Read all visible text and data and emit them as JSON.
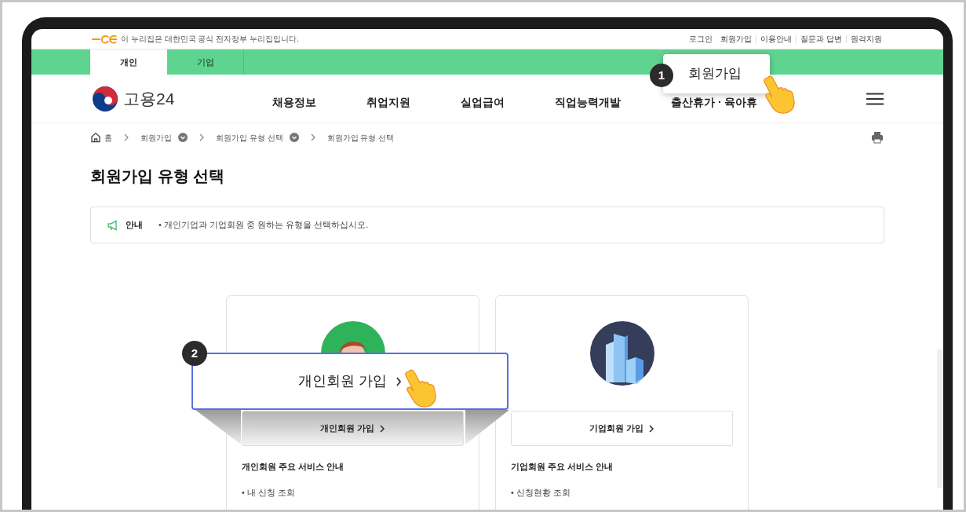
{
  "gov_banner": {
    "text": "이 누리집은 대한민국 공식 전자정부 누리집입니다."
  },
  "utility_links": [
    {
      "label": "로그인"
    },
    {
      "label": "회원가입"
    },
    {
      "label": "이용안내"
    },
    {
      "label": "질문과 답변"
    },
    {
      "label": "원격지원"
    }
  ],
  "audience_tabs": [
    {
      "label": "개인",
      "selected": true
    },
    {
      "label": "기업",
      "selected": false
    }
  ],
  "header": {
    "logo_text": "고용24",
    "nav": [
      "채용정보",
      "취업지원",
      "실업급여",
      "직업능력개발",
      "출산휴가 · 육아휴"
    ]
  },
  "breadcrumb": [
    {
      "label": "홈",
      "kind": "home"
    },
    {
      "label": "회원가입",
      "kind": "dropdown"
    },
    {
      "label": "회원가입 유형 선택",
      "kind": "dropdown"
    },
    {
      "label": "회원가입 유형 선택",
      "kind": "current"
    }
  ],
  "page_title": "회원가입 유형 선택",
  "notice": {
    "label": "안내",
    "text": "• 개인기업과 기업회원 중 원하는 유형을 선택하십시오."
  },
  "cards": [
    {
      "kind": "person",
      "button": "개인회원 가입",
      "section_title": "개인회원 주요 서비스 안내",
      "items": [
        "• 내 신청 조회"
      ]
    },
    {
      "kind": "company",
      "button": "기업회원 가입",
      "section_title": "기업회원 주요 서비스 안내",
      "items": [
        "• 신청현황 조회"
      ]
    }
  ],
  "callouts": [
    {
      "number": "1",
      "text": "회원가입"
    },
    {
      "number": "2",
      "text": "개인회원 가입"
    }
  ]
}
